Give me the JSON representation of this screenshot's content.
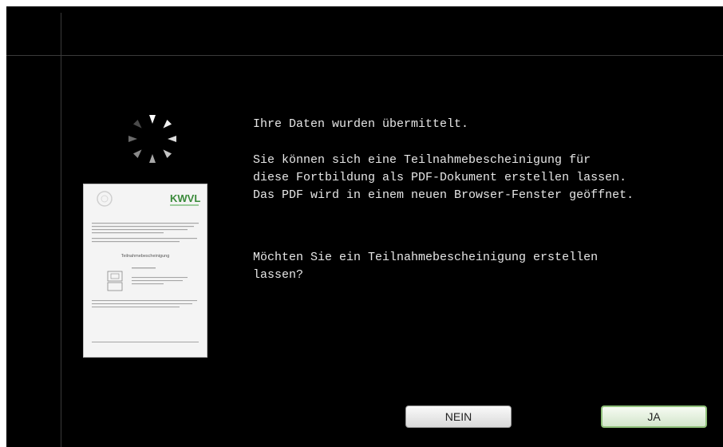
{
  "message": {
    "line1": "Ihre Daten wurden übermittelt.",
    "paragraph2": "Sie können sich eine Teilnahmebescheinigung für\ndiese Fortbildung als PDF-Dokument erstellen lassen.\nDas PDF wird in einem neuen Browser-Fenster geöffnet.",
    "question": "Möchten Sie ein Teilnahmebescheinigung erstellen\nlassen?"
  },
  "preview": {
    "logo_text": "KWVL",
    "doc_title": "Teilnahmebescheinigung"
  },
  "buttons": {
    "no_label": "NEIN",
    "yes_label": "JA"
  },
  "colors": {
    "background": "#000000",
    "text": "#e6e6e6",
    "logo": "#3a8a3a",
    "yes_border": "#8fc07a"
  },
  "icons": {
    "spinner": "loading-spinner-icon"
  }
}
